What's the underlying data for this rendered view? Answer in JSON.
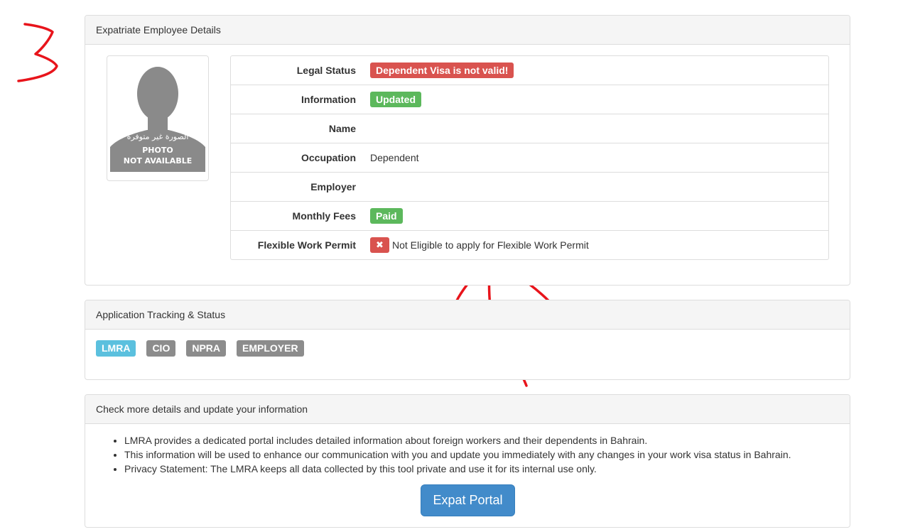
{
  "details_panel": {
    "title": "Expatriate Employee Details",
    "photo": {
      "caption_ar": "الصورة غير متوفرة",
      "caption_line1": "PHOTO",
      "caption_line2": "NOT AVAILABLE"
    },
    "rows": [
      {
        "label": "Legal Status",
        "badge": "Dependent Visa is not valid!",
        "badge_color": "#d9534f"
      },
      {
        "label": "Information",
        "badge": "Updated",
        "badge_color": "#5cb85c"
      },
      {
        "label": "Name",
        "value": ""
      },
      {
        "label": "Occupation",
        "value": "Dependent"
      },
      {
        "label": "Employer",
        "value": ""
      },
      {
        "label": "Monthly Fees",
        "badge": "Paid",
        "badge_color": "#5cb85c"
      },
      {
        "label": "Flexible Work Permit",
        "icon": "x-icon",
        "value": "Not Eligible to apply for Flexible Work Permit"
      }
    ]
  },
  "tracking_panel": {
    "title": "Application Tracking & Status",
    "stages": [
      {
        "label": "LMRA",
        "color": "#5bc0de"
      },
      {
        "label": "CIO",
        "color": "#8c8c8c"
      },
      {
        "label": "NPRA",
        "color": "#8c8c8c"
      },
      {
        "label": "EMPLOYER",
        "color": "#8c8c8c"
      }
    ]
  },
  "more_panel": {
    "title": "Check more details and update your information",
    "bullets": [
      "LMRA provides a dedicated portal includes detailed information about foreign workers and their dependents in Bahrain.",
      "This information will be used to enhance our communication with you and update you immediately with any changes in your work visa status in Bahrain.",
      "Privacy Statement: The LMRA keeps all data collected by this tool private and use it for its internal use only."
    ],
    "button_label": "Expat Portal"
  },
  "annotation": {
    "digit": "3",
    "arrow_color": "#e8141b"
  }
}
